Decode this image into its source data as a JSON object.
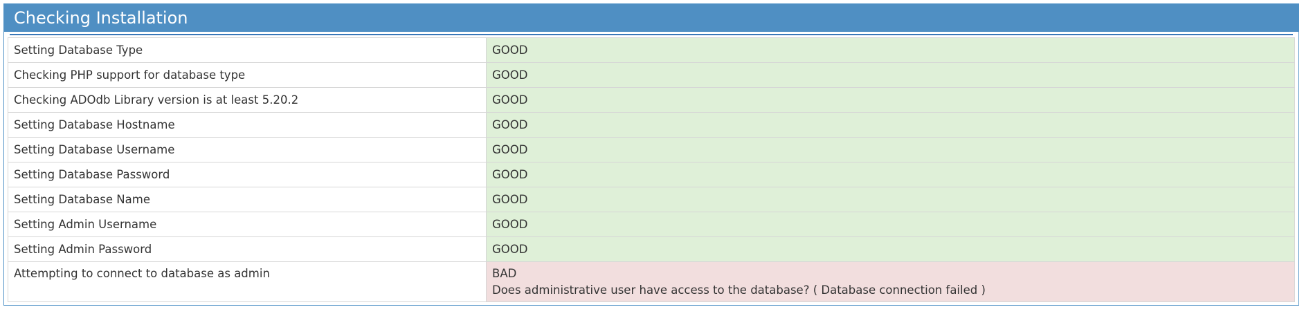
{
  "header": {
    "title": "Checking Installation"
  },
  "checks": [
    {
      "label": "Setting Database Type",
      "status": "GOOD"
    },
    {
      "label": "Checking PHP support for database type",
      "status": "GOOD"
    },
    {
      "label": "Checking ADOdb Library version is at least 5.20.2",
      "status": "GOOD"
    },
    {
      "label": "Setting Database Hostname",
      "status": "GOOD"
    },
    {
      "label": "Setting Database Username",
      "status": "GOOD"
    },
    {
      "label": "Setting Database Password",
      "status": "GOOD"
    },
    {
      "label": "Setting Database Name",
      "status": "GOOD"
    },
    {
      "label": "Setting Admin Username",
      "status": "GOOD"
    },
    {
      "label": "Setting Admin Password",
      "status": "GOOD"
    },
    {
      "label": "Attempting to connect to database as admin",
      "status": "BAD",
      "detail": "Does administrative user have access to the database? ( Database connection failed )"
    }
  ],
  "colors": {
    "header_bg": "#4f8fc3",
    "good_bg": "#dff0d8",
    "bad_bg": "#f2dede"
  }
}
